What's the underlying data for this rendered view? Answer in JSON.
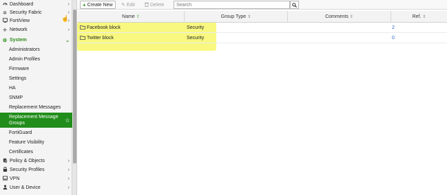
{
  "sidebar": {
    "top_items": [
      {
        "label": "Dashboard",
        "icon": "dashboard-icon"
      },
      {
        "label": "Security Fabric",
        "icon": "fabric-icon"
      },
      {
        "label": "FortiView",
        "icon": "fortiview-icon"
      },
      {
        "label": "Network",
        "icon": "network-icon"
      }
    ],
    "system": {
      "label": "System",
      "icon": "gear-icon"
    },
    "system_children": [
      {
        "label": "Administrators"
      },
      {
        "label": "Admin Profiles"
      },
      {
        "label": "Firmware"
      },
      {
        "label": "Settings"
      },
      {
        "label": "HA"
      },
      {
        "label": "SNMP"
      },
      {
        "label": "Replacement Messages"
      },
      {
        "label": "Replacement Message Groups"
      },
      {
        "label": "FortiGuard"
      },
      {
        "label": "Feature Visibility"
      },
      {
        "label": "Certificates"
      }
    ],
    "bottom_items": [
      {
        "label": "Policy & Objects",
        "icon": "policy-icon"
      },
      {
        "label": "Security Profiles",
        "icon": "lock-icon"
      },
      {
        "label": "VPN",
        "icon": "vpn-icon"
      },
      {
        "label": "User & Device",
        "icon": "user-icon"
      }
    ]
  },
  "toolbar": {
    "create_label": "Create New",
    "edit_label": "Edit",
    "delete_label": "Delete",
    "search_placeholder": "Search"
  },
  "table": {
    "columns": [
      "Name",
      "Group Type",
      "Comments",
      "Ref."
    ],
    "rows": [
      {
        "name": "Facebook block",
        "group_type": "Security",
        "comments": "",
        "ref": "2"
      },
      {
        "name": "Twitter block",
        "group_type": "Security",
        "comments": "",
        "ref": "0"
      }
    ]
  },
  "colors": {
    "accent": "#218d1b",
    "highlight": "#f7f76a",
    "link": "#2a66c4"
  }
}
